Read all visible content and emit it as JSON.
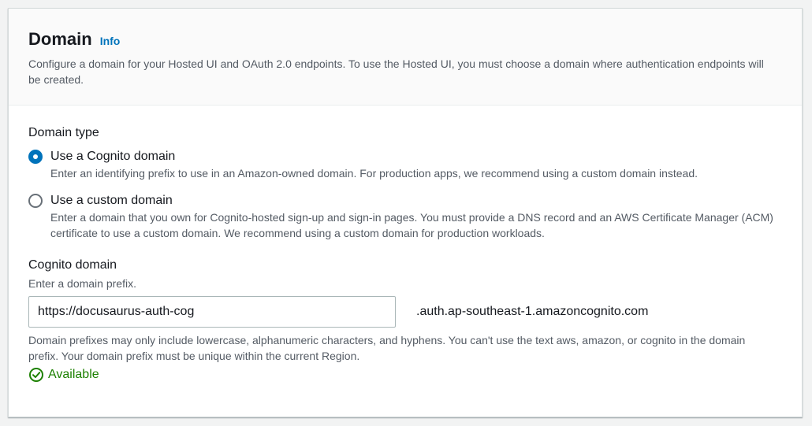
{
  "header": {
    "title": "Domain",
    "info_link": "Info",
    "description": "Configure a domain for your Hosted UI and OAuth 2.0 endpoints. To use the Hosted UI, you must choose a domain where authentication endpoints will be created."
  },
  "domain_type": {
    "label": "Domain type",
    "options": [
      {
        "label": "Use a Cognito domain",
        "description": "Enter an identifying prefix to use in an Amazon-owned domain. For production apps, we recommend using a custom domain instead.",
        "selected": true
      },
      {
        "label": "Use a custom domain",
        "description": "Enter a domain that you own for Cognito-hosted sign-up and sign-in pages. You must provide a DNS record and an AWS Certificate Manager (ACM) certificate to use a custom domain. We recommend using a custom domain for production workloads.",
        "selected": false
      }
    ]
  },
  "cognito_domain": {
    "label": "Cognito domain",
    "hint": "Enter a domain prefix.",
    "value": "https://docusaurus-auth-cog",
    "suffix": ".auth.ap-southeast-1.amazoncognito.com",
    "constraint": "Domain prefixes may only include lowercase, alphanumeric characters, and hyphens. You can't use the text aws, amazon, or cognito in the domain prefix. Your domain prefix must be unique within the current Region.",
    "status": "Available",
    "status_icon": "check-circle-icon"
  },
  "colors": {
    "accent": "#0073bb",
    "success": "#1d8102",
    "secondary_text": "#545b64"
  }
}
